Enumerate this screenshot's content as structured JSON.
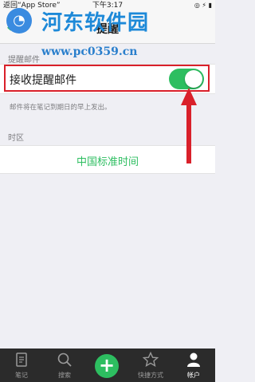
{
  "status_bar": {
    "back": "返回“App Store”",
    "time": "下午3:17",
    "right": "◎ ⚡ ▮"
  },
  "nav": {
    "back_icon": "‹",
    "title": "提醒"
  },
  "watermark": {
    "title": "河东软件园",
    "url": "www.pc0359.cn"
  },
  "sections": {
    "email_header": "提醒邮件",
    "email_toggle_label": "接收提醒邮件",
    "email_toggle_on": true,
    "email_hint": "邮件将在笔记到期日的早上发出。",
    "timezone_header": "时区",
    "timezone_value": "中国标准时间"
  },
  "tabs": [
    {
      "label": "笔记",
      "icon": "notes-icon"
    },
    {
      "label": "搜索",
      "icon": "search-icon"
    },
    {
      "label": "",
      "icon": "plus-icon"
    },
    {
      "label": "快捷方式",
      "icon": "star-icon"
    },
    {
      "label": "帐户",
      "icon": "account-icon"
    }
  ],
  "colors": {
    "accent": "#2dbe60",
    "highlight": "#d9202a",
    "tabbar": "#2b2b2b"
  }
}
